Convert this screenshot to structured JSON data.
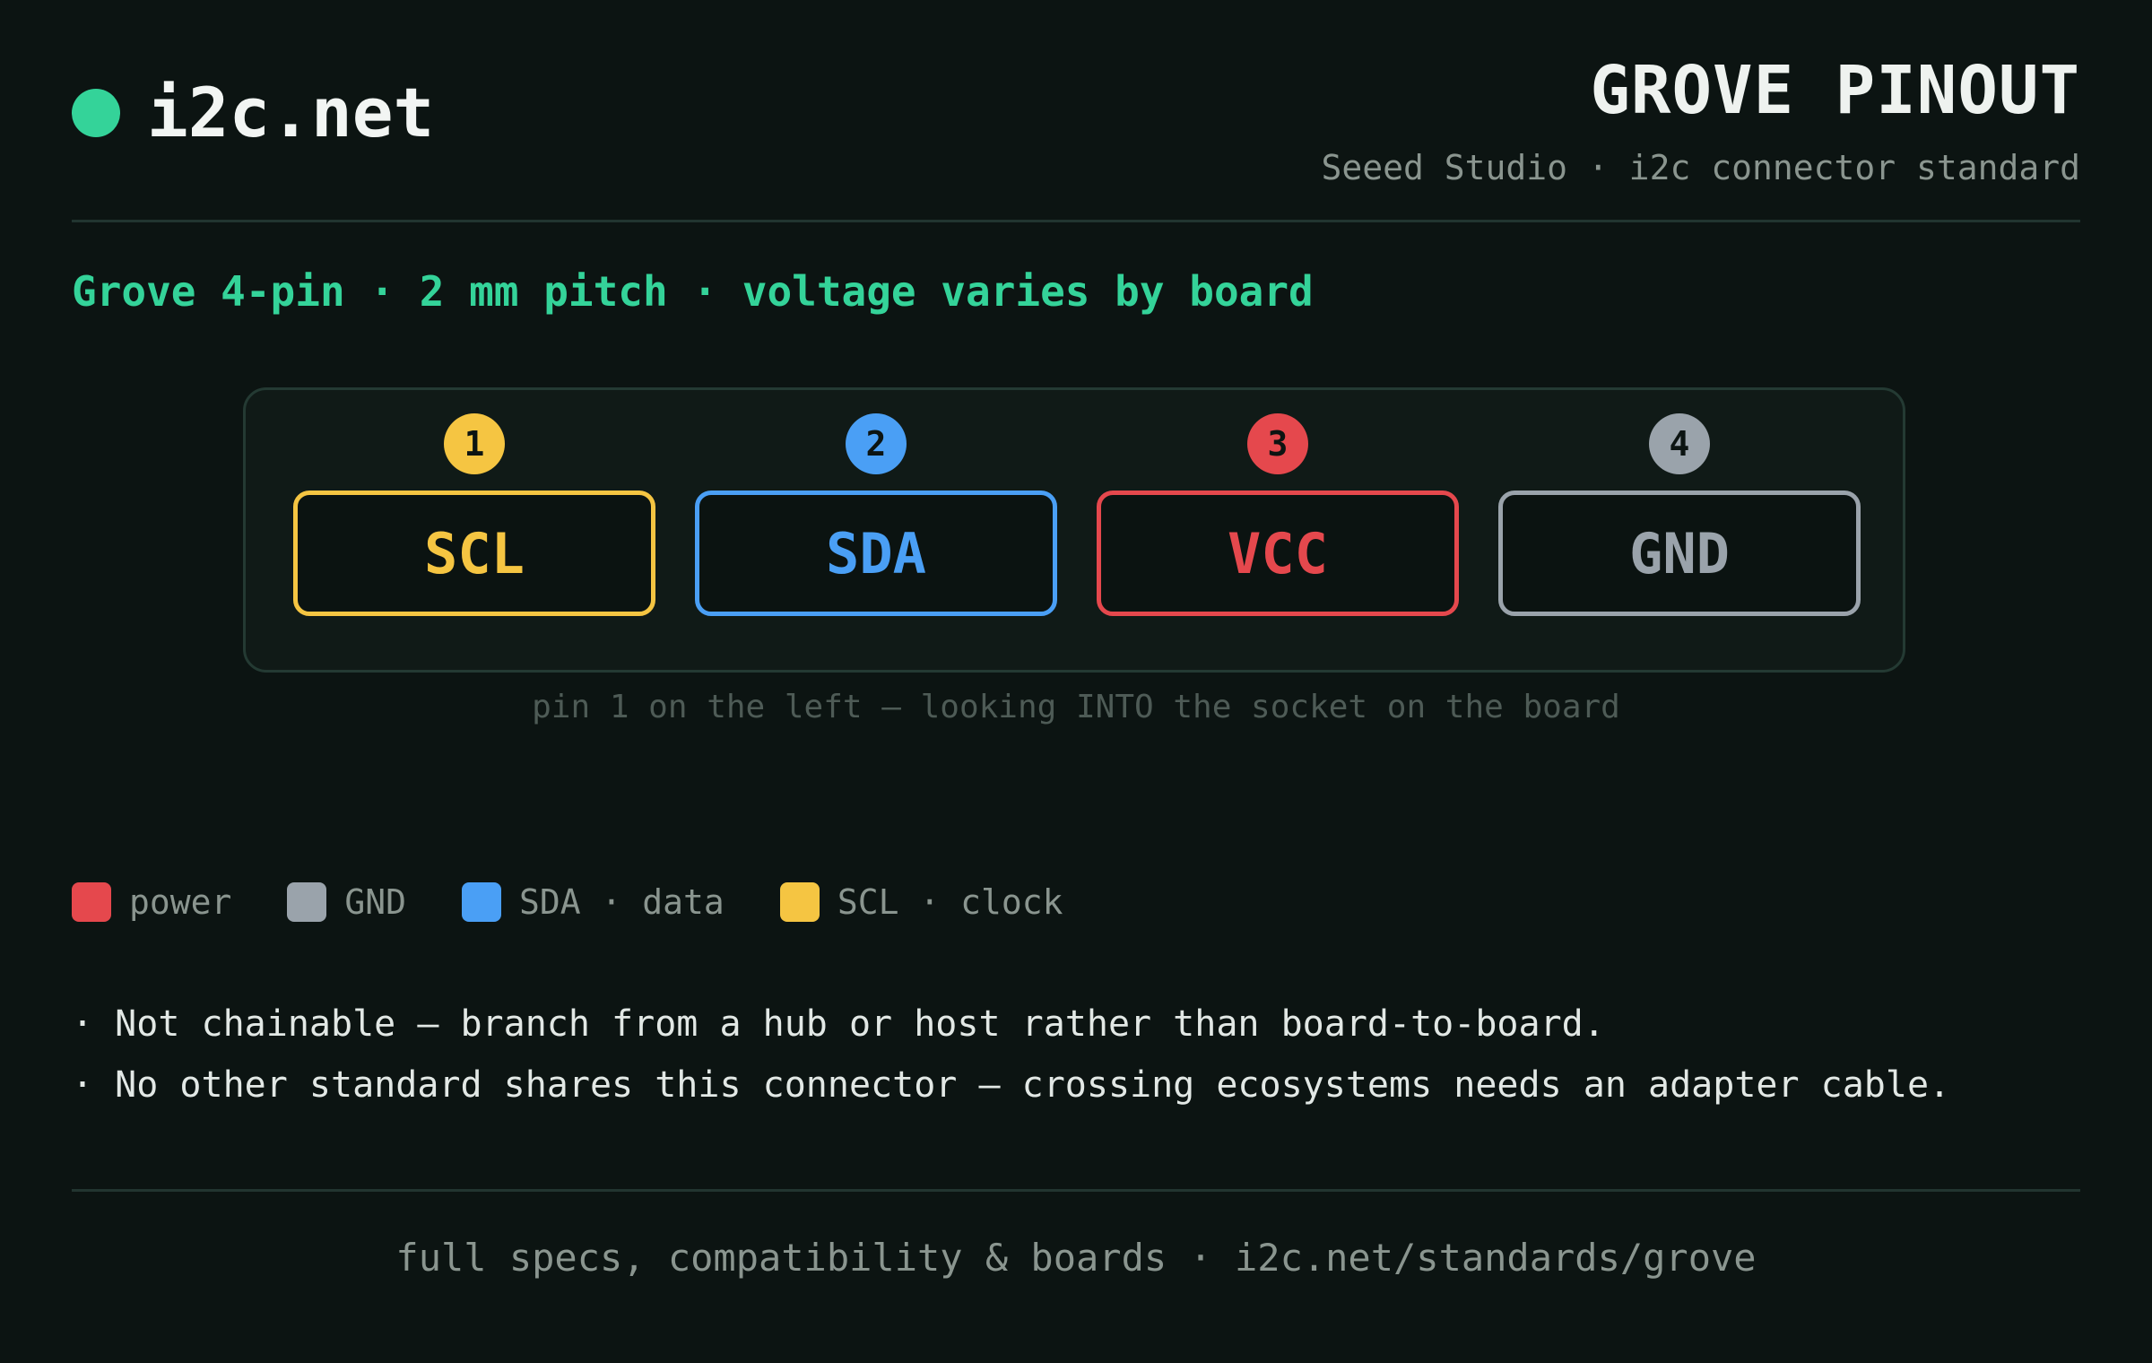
{
  "header": {
    "brand_name": "i2c.net",
    "title": "GROVE PINOUT",
    "subtitle": "Seeed Studio · i2c connector standard"
  },
  "spec_line": "Grove 4-pin · 2 mm pitch · voltage varies by board",
  "pins": [
    {
      "number": "1",
      "label": "SCL",
      "color": "#f5c542"
    },
    {
      "number": "2",
      "label": "SDA",
      "color": "#4a9ff5"
    },
    {
      "number": "3",
      "label": "VCC",
      "color": "#e5484d"
    },
    {
      "number": "4",
      "label": "GND",
      "color": "#9aa3ab"
    }
  ],
  "connector_caption": "pin 1 on the left — looking INTO the socket on the board",
  "legend": [
    {
      "label": "power",
      "color": "#e5484d"
    },
    {
      "label": "GND",
      "color": "#9aa3ab"
    },
    {
      "label": "SDA · data",
      "color": "#4a9ff5"
    },
    {
      "label": "SCL · clock",
      "color": "#f5c542"
    }
  ],
  "notes": [
    "· Not chainable — branch from a hub or host rather than board-to-board.",
    "· No other standard shares this connector — crossing ecosystems needs an adapter cable."
  ],
  "footer": "full specs, compatibility & boards · i2c.net/standards/grove",
  "colors": {
    "accent": "#34d399",
    "background": "#0c1412"
  }
}
